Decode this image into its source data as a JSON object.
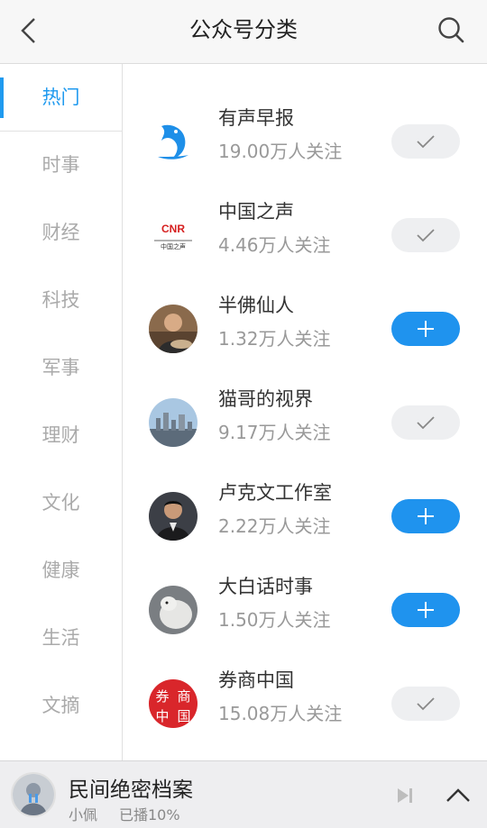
{
  "header": {
    "title": "公众号分类"
  },
  "categories": [
    {
      "label": "热门",
      "active": true
    },
    {
      "label": "时事"
    },
    {
      "label": "财经"
    },
    {
      "label": "科技"
    },
    {
      "label": "军事"
    },
    {
      "label": "理财"
    },
    {
      "label": "文化"
    },
    {
      "label": "健康"
    },
    {
      "label": "生活"
    },
    {
      "label": "文摘"
    }
  ],
  "accounts": [
    {
      "name": "有声早报",
      "followers": "19.00万人关注",
      "followed": true,
      "avatar_icon": "blue-dolphin-logo"
    },
    {
      "name": "中国之声",
      "followers": "4.46万人关注",
      "followed": true,
      "avatar_icon": "cnr-logo",
      "logo_text": "CNR",
      "logo_subtext": "中国之声"
    },
    {
      "name": "半佛仙人",
      "followers": "1.32万人关注",
      "followed": false,
      "avatar_icon": "person-photo"
    },
    {
      "name": "猫哥的视界",
      "followers": "9.17万人关注",
      "followed": true,
      "avatar_icon": "city-skyline-photo"
    },
    {
      "name": "卢克文工作室",
      "followers": "2.22万人关注",
      "followed": false,
      "avatar_icon": "person-photo"
    },
    {
      "name": "大白话时事",
      "followers": "1.50万人关注",
      "followed": false,
      "avatar_icon": "white-animal-photo"
    },
    {
      "name": "券商中国",
      "followers": "15.08万人关注",
      "followed": true,
      "avatar_icon": "red-seal-logo",
      "logo_chars": [
        "券",
        "商",
        "中",
        "国"
      ]
    }
  ],
  "player": {
    "title": "民间绝密档案",
    "author": "小佩",
    "progress_text": "已播10%"
  },
  "colors": {
    "accent": "#1f9aef",
    "add_button": "#1f93ee",
    "followed_button": "#eeeff1",
    "muted_text": "#aaaaaa"
  }
}
